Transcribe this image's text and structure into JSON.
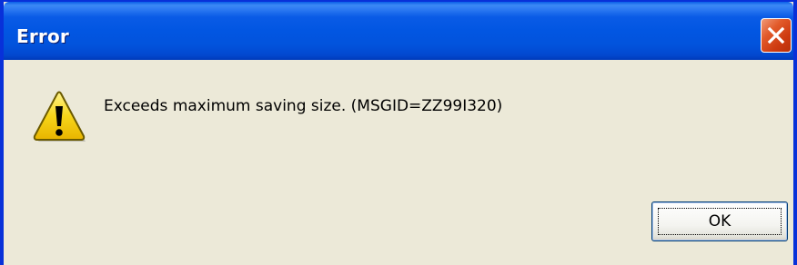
{
  "window": {
    "title": "Error",
    "accent_color": "#0831d9",
    "close_button_color": "#e25a2a"
  },
  "dialog": {
    "icon": "warning-icon",
    "message": "Exceeds maximum saving size. (MSGID=ZZ99I320)",
    "ok_label": "OK"
  }
}
